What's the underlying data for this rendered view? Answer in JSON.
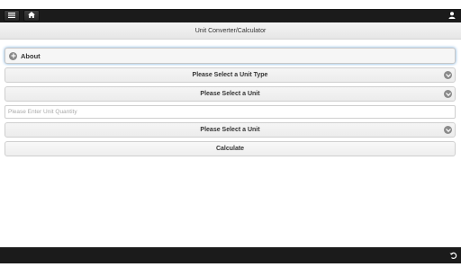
{
  "header": {
    "title": "Unit Converter/Calculator"
  },
  "about": {
    "label": "About"
  },
  "form": {
    "unit_type_select": "Please Select a Unit Type",
    "from_unit_select": "Please Select a Unit",
    "quantity_placeholder": "Please Enter Unit Quantity",
    "to_unit_select": "Please Select a Unit",
    "calculate_label": "Calculate"
  },
  "icons": {
    "menu": "menu-icon",
    "home": "home-icon",
    "user": "user-icon",
    "about": "plus-circle-icon",
    "select": "chevron-down-icon",
    "back": "back-icon"
  },
  "colors": {
    "toolbar": "#1b1b1b",
    "header_bg": "#e9e9e9",
    "focus_glow": "#6fa8dc"
  }
}
